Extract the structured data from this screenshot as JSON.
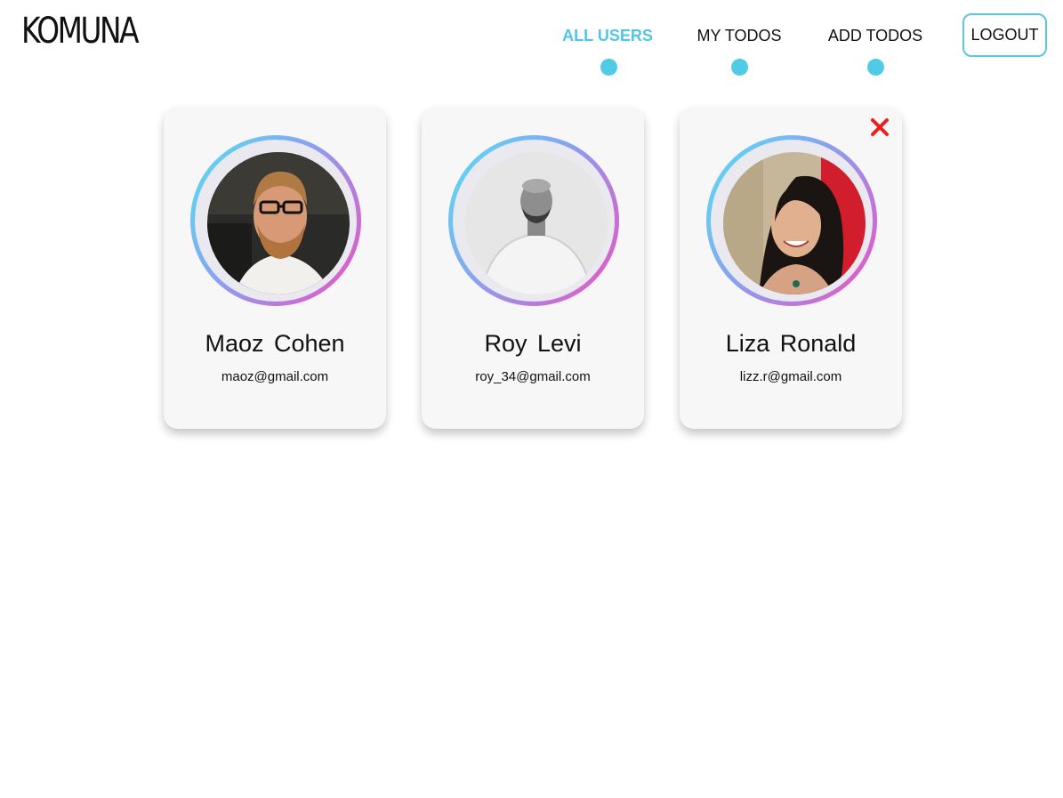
{
  "brand": {
    "logo_text": "KOMUNA"
  },
  "nav": {
    "items": [
      {
        "label": "ALL USERS",
        "active": true
      },
      {
        "label": "MY TODOS",
        "active": false
      },
      {
        "label": "ADD TODOS",
        "active": false
      }
    ],
    "logout_label": "LOGOUT"
  },
  "colors": {
    "accent": "#4fcbe6",
    "delete": "#e8211f",
    "ring_gradient": [
      "#55e3f2",
      "#8aa0f0",
      "#f04fc0"
    ]
  },
  "users": [
    {
      "name": "Maoz  Cohen",
      "email": "maoz@gmail.com",
      "avatar": "man-glasses-beard-photo",
      "deletable": false
    },
    {
      "name": "Roy  Levi",
      "email": "roy_34@gmail.com",
      "avatar": "bald-man-grayscale-photo",
      "deletable": false
    },
    {
      "name": "Liza  Ronald",
      "email": "lizz.r@gmail.com",
      "avatar": "smiling-woman-photo",
      "deletable": true
    }
  ]
}
